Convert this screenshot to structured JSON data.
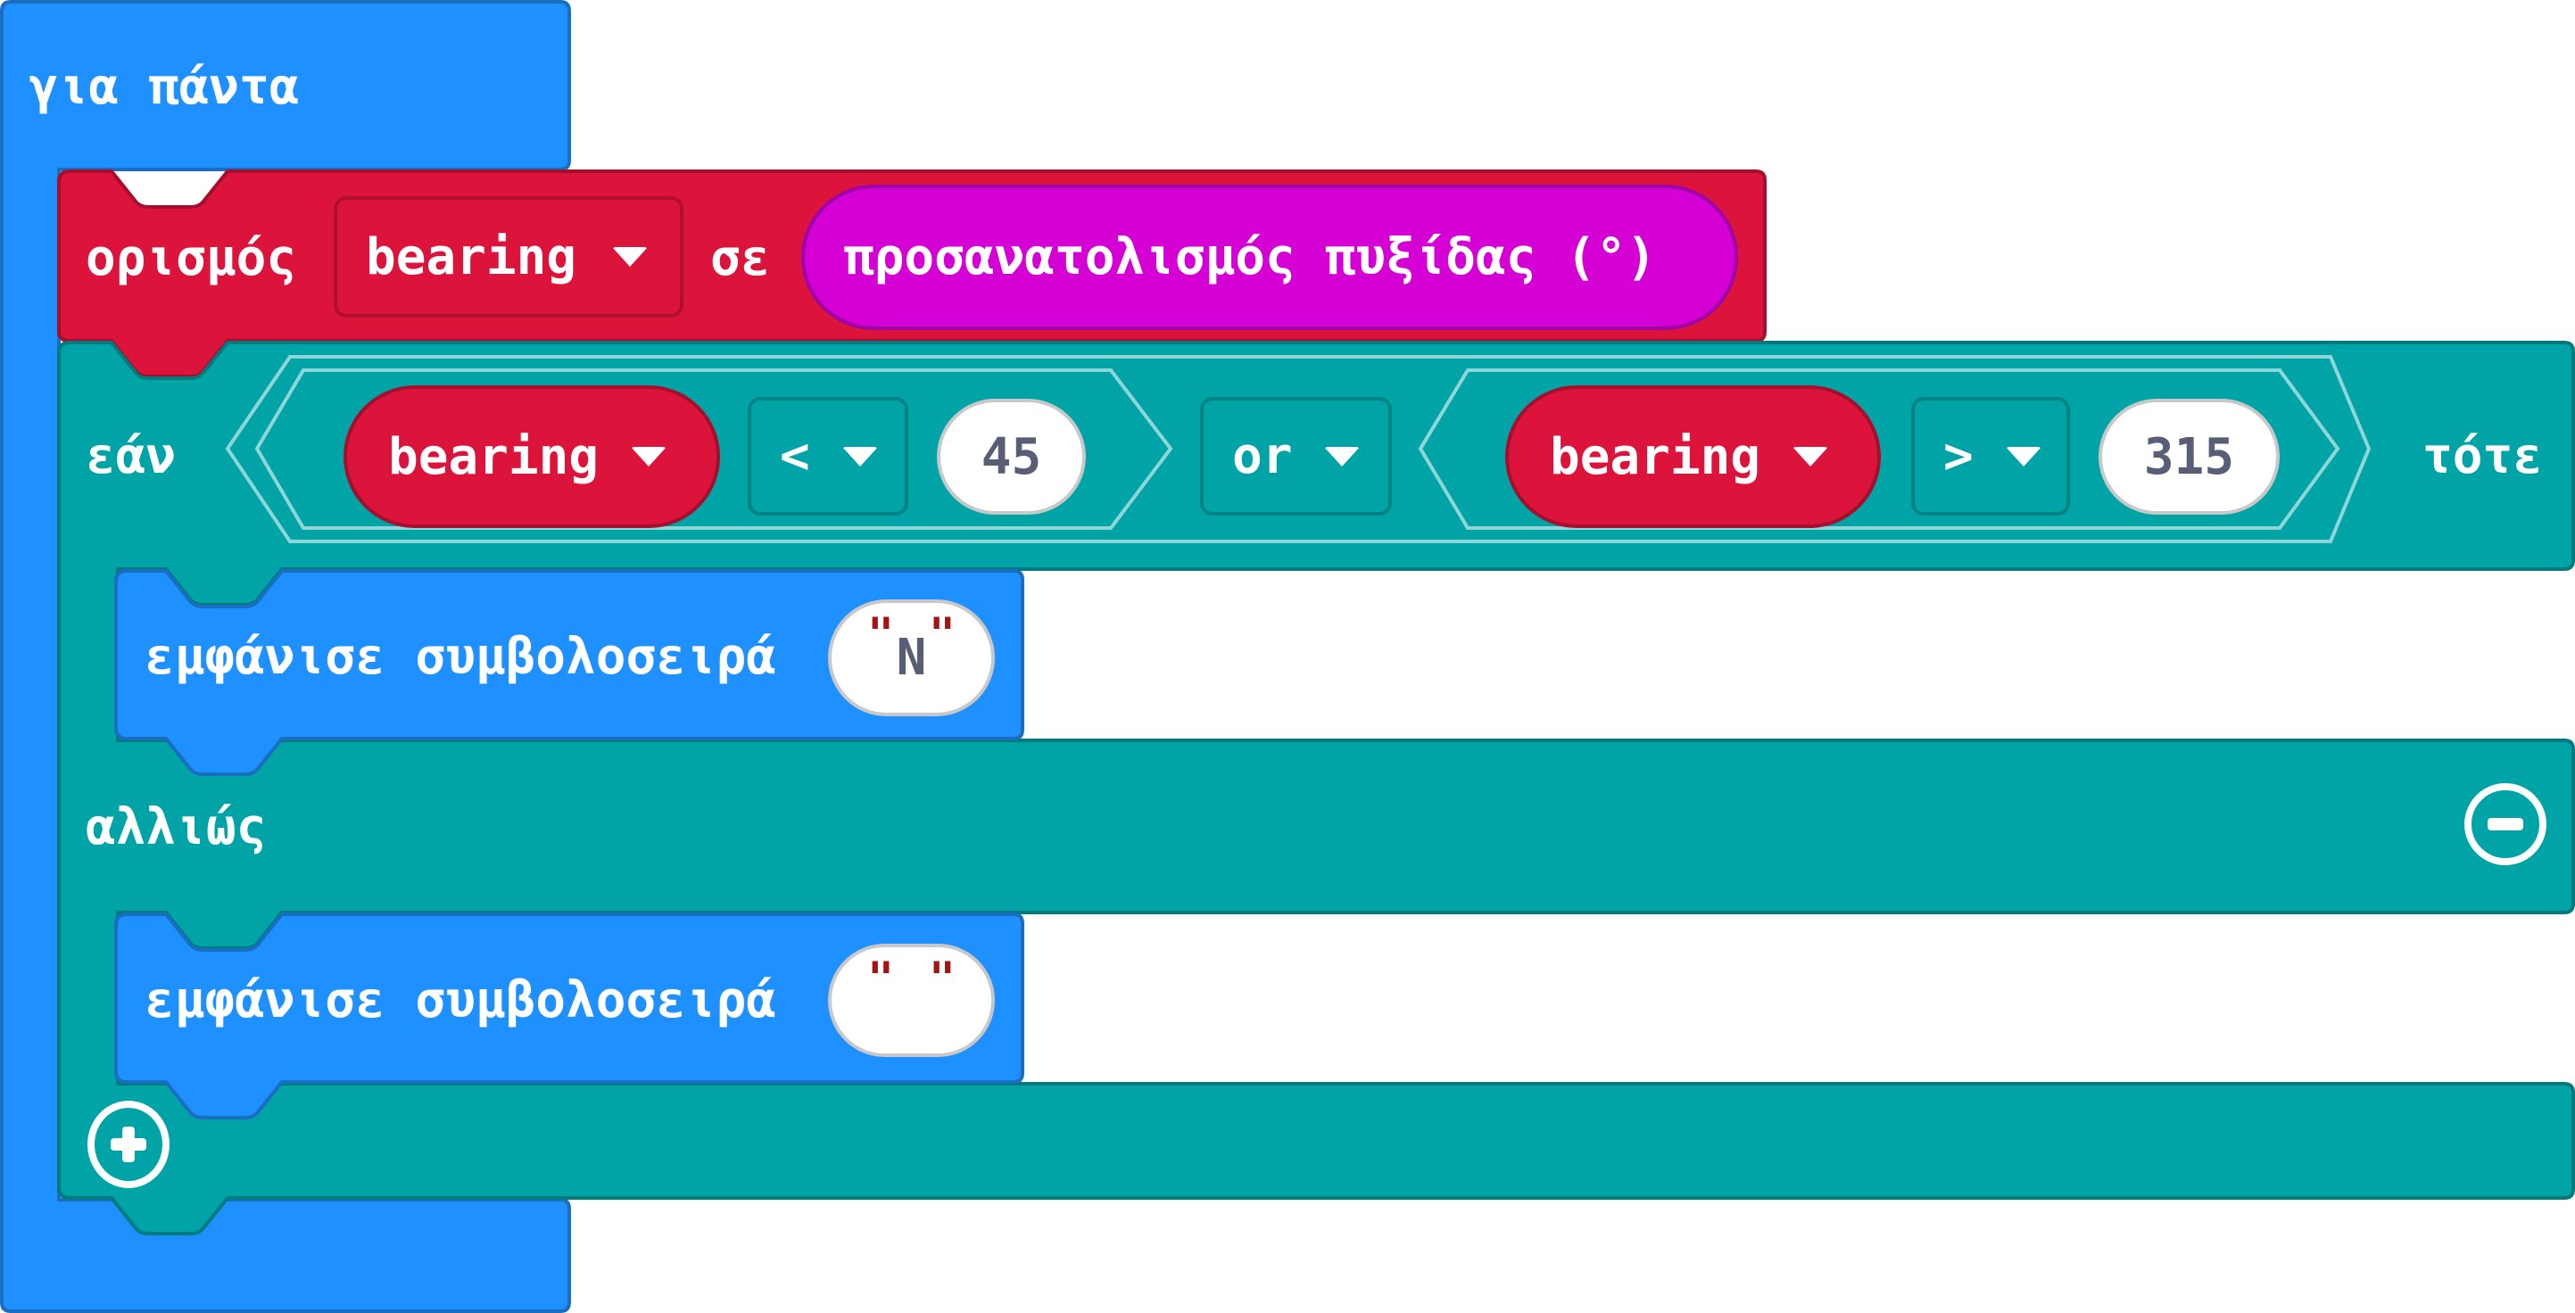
{
  "forever_block": {
    "label": "για πάντα",
    "color": "#1e90ff"
  },
  "set_block": {
    "label": "ορισμός",
    "variable": "bearing",
    "to_label": "σε",
    "value_block": {
      "label": "προσανατολισμός πυξίδας (°)",
      "color": "#d400d4"
    },
    "color": "#dc143c"
  },
  "if_block": {
    "if_label": "εάν",
    "then_label": "τότε",
    "else_label": "αλλιώς",
    "color": "#00a4a6",
    "condition": {
      "left": {
        "variable": "bearing",
        "operator": "<",
        "value": "45"
      },
      "logic_operator": "or",
      "right": {
        "variable": "bearing",
        "operator": ">",
        "value": "315"
      }
    },
    "remove_else_icon": "minus-circle-icon",
    "add_branch_icon": "plus-circle-icon"
  },
  "then_branch": {
    "label": "εμφάνισε συμβολοσειρά",
    "string_value": "N"
  },
  "else_branch": {
    "label": "εμφάνισε συμβολοσειρά",
    "string_value": " "
  },
  "dropdown_icon": "triangle-down-icon",
  "quote_char": "\""
}
